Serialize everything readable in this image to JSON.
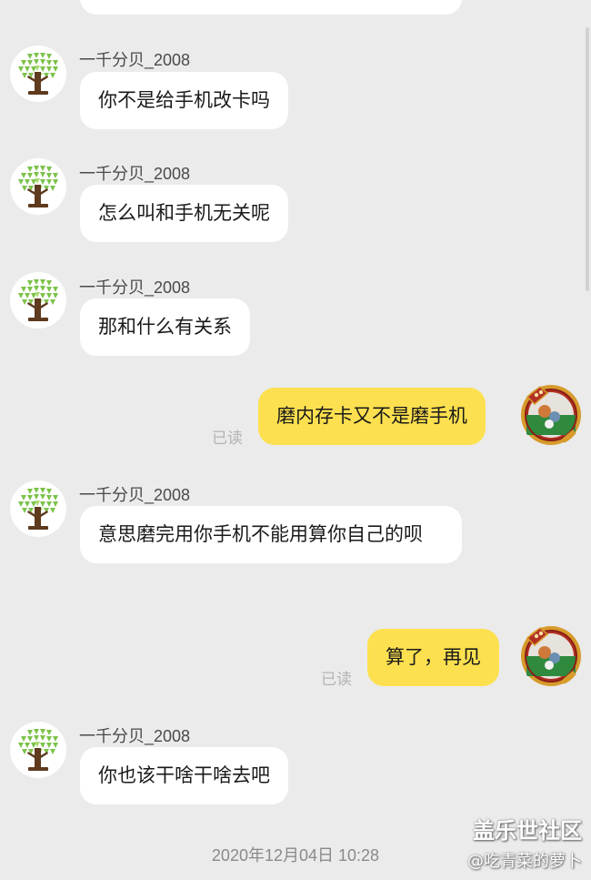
{
  "messages": [
    {
      "sender": "一千分贝_2008",
      "text": "你不是给手机改卡吗"
    },
    {
      "sender": "一千分贝_2008",
      "text": "怎么叫和手机无关呢"
    },
    {
      "sender": "一千分贝_2008",
      "text": "那和什么有关系"
    },
    {
      "text": "磨内存卡又不是磨手机",
      "status": "已读"
    },
    {
      "sender": "一千分贝_2008",
      "text": "意思磨完用你手机不能用算你自己的呗"
    },
    {
      "text": "算了，再见",
      "status": "已读"
    },
    {
      "sender": "一千分贝_2008",
      "text": "你也该干啥干啥去吧"
    }
  ],
  "timestamp": "2020年12月04日 10:28",
  "watermark": {
    "brand": "盖乐世社区",
    "user": "@吃青菜的萝卜"
  },
  "colors": {
    "background": "#ebebeb",
    "incoming_bubble": "#ffffff",
    "outgoing_bubble": "#fde04f"
  },
  "icons": {
    "contact_avatar": "tree-avatar-icon",
    "self_avatar": "badge-avatar-icon"
  }
}
